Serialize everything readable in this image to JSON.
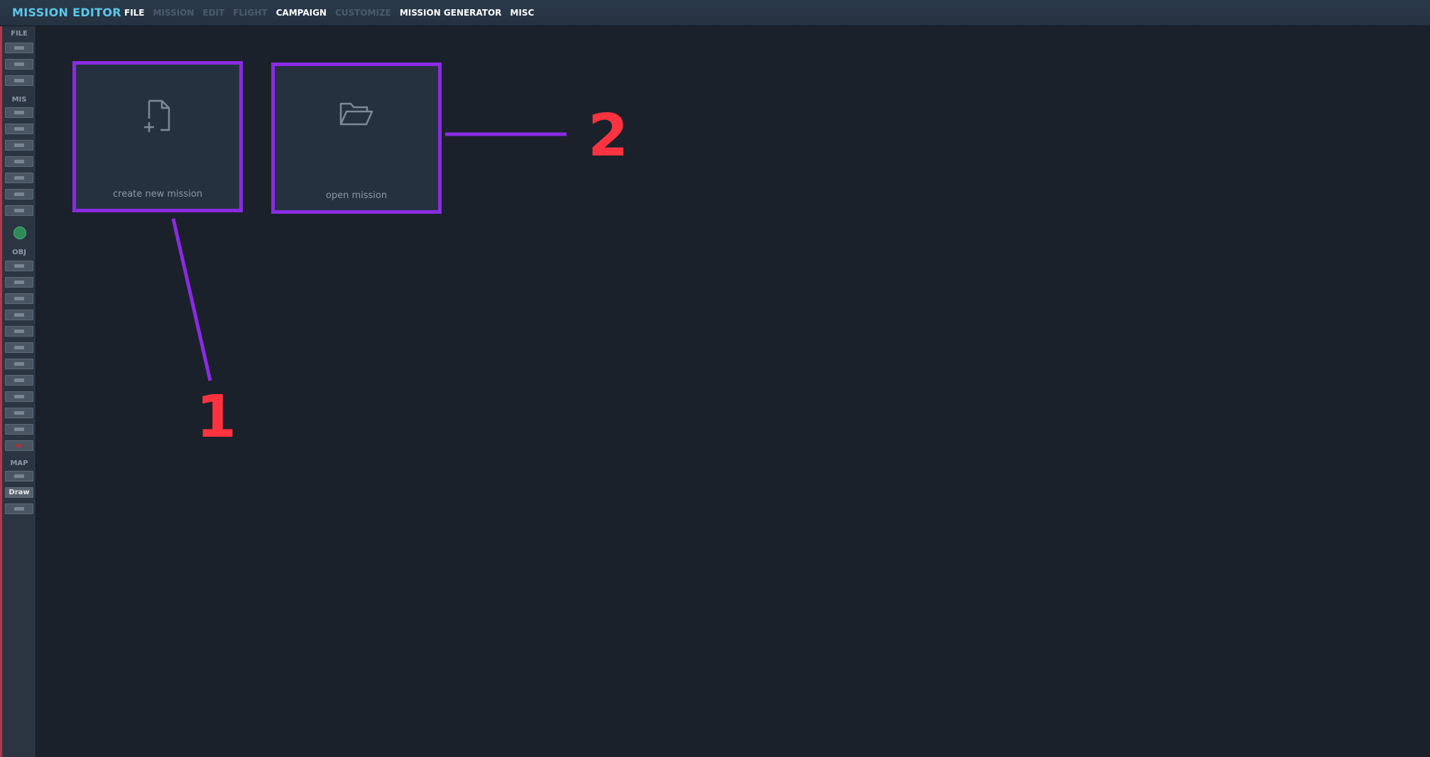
{
  "app_title": "MISSION EDITOR",
  "menu": [
    {
      "label": "FILE",
      "enabled": true
    },
    {
      "label": "MISSION",
      "enabled": false
    },
    {
      "label": "EDIT",
      "enabled": false
    },
    {
      "label": "FLIGHT",
      "enabled": false
    },
    {
      "label": "CAMPAIGN",
      "enabled": true
    },
    {
      "label": "CUSTOMIZE",
      "enabled": false
    },
    {
      "label": "MISSION GENERATOR",
      "enabled": true
    },
    {
      "label": "MISC",
      "enabled": true
    }
  ],
  "sidebar": {
    "file_label": "FILE",
    "mis_label": "MIS",
    "obj_label": "OBJ",
    "map_label": "MAP",
    "draw_label": "Draw"
  },
  "tiles": {
    "create": {
      "label": "create new mission",
      "icon": "new-file-icon"
    },
    "open": {
      "label": "open mission",
      "icon": "folder-open-icon"
    }
  },
  "annotations": {
    "one": "1",
    "two": "2"
  },
  "colors": {
    "accent": "#5bc8ea",
    "highlight_border": "#8a2be2",
    "annotation": "#ff3340",
    "background": "#1a212b"
  }
}
